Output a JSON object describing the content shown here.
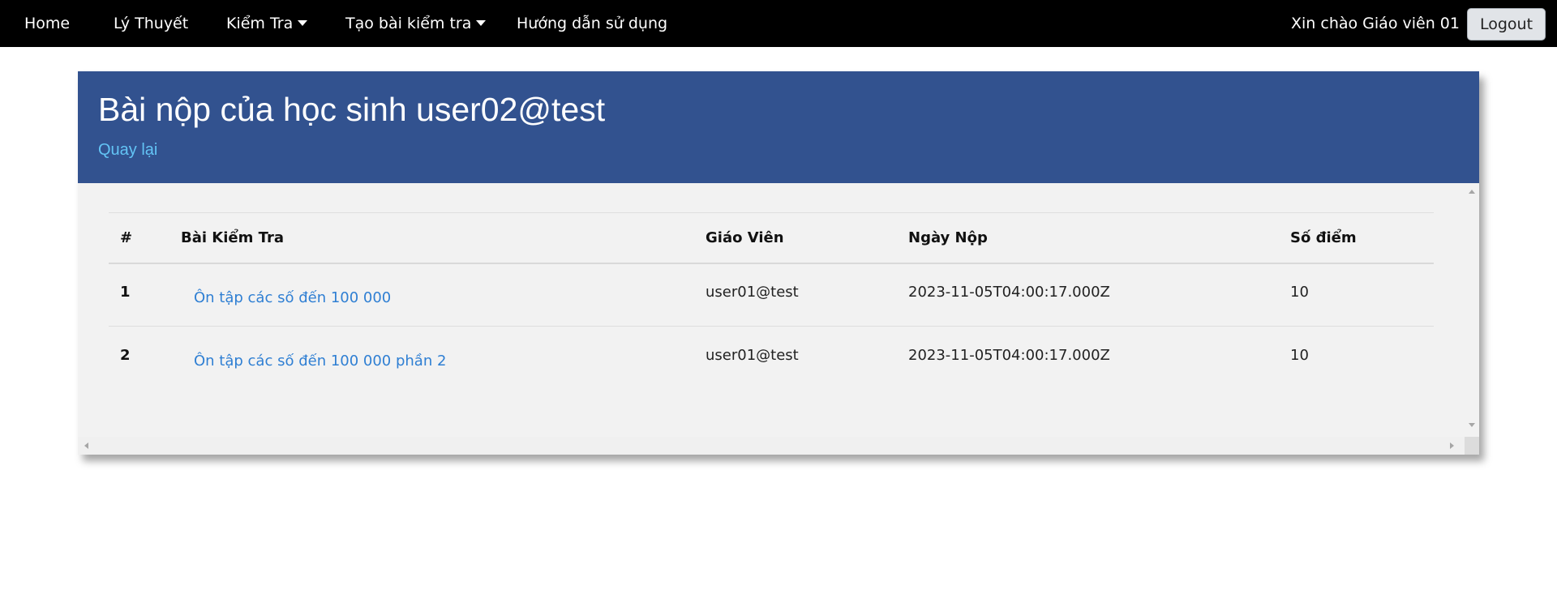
{
  "nav": {
    "home": "Home",
    "theory": "Lý Thuyết",
    "tests": "Kiểm Tra",
    "create_test": "Tạo bài kiểm tra",
    "guide": "Hướng dẫn sử dụng",
    "greeting": "Xin chào Giáo viên 01",
    "logout": "Logout"
  },
  "header": {
    "title": "Bài nộp của học sinh user02@test",
    "back_link": "Quay lại"
  },
  "table": {
    "columns": [
      "#",
      "Bài Kiểm Tra",
      "Giáo Viên",
      "Ngày Nộp",
      "Số điểm"
    ],
    "rows": [
      {
        "index": "1",
        "test": "Ôn tập các số đến 100 000",
        "teacher": "user01@test",
        "submitted": "2023-11-05T04:00:17.000Z",
        "score": "10"
      },
      {
        "index": "2",
        "test": "Ôn tập các số đến 100 000 phần 2",
        "teacher": "user01@test",
        "submitted": "2023-11-05T04:00:17.000Z",
        "score": "10"
      }
    ]
  },
  "colors": {
    "navbar": "#000000",
    "header": "#32528f",
    "back_link": "#63c4f5",
    "table_link": "#2f7fd3",
    "card_body": "#f2f2f2"
  }
}
